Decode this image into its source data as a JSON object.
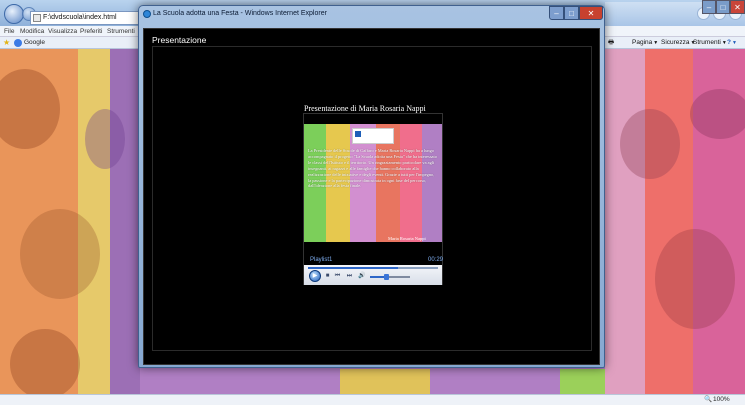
{
  "browser": {
    "address": "F:\\dvdscuola\\index.html",
    "menu": [
      "File",
      "Modifica",
      "Visualizza",
      "Preferiti",
      "Strumenti"
    ],
    "favorites": {
      "google_label": "Google"
    },
    "commands": {
      "page": "Pagina",
      "security": "Sicurezza",
      "tools": "Strumenti",
      "help": "?"
    },
    "zoom": "100%",
    "window_controls": {
      "minimize": "–",
      "maximize": "□",
      "close": "✕"
    }
  },
  "popup": {
    "title": "La Scuola adotta una Festa - Windows Internet Explorer",
    "heading": "Presentazione",
    "video_title": "Presentazione di Maria Rosaria Nappi",
    "slide": {
      "text": "La Presidente delle Scuole di Caffaro e Maria Rosaria Nappi ha a lungo accompagnato il progetto \"La Scuola adotta una Festa\" che ha interessato le classi dell'Istituto e il territorio. Un ringraziamento particolare va agli insegnanti, ai ragazzi e alle famiglie che hanno collaborato alla realizzazione delle iniziative e degli eventi. Grazie a tutti per l'impegno, la passione e la partecipazione dimostrata in ogni fase del percorso, dall'ideazione alla festa finale.",
      "signature": "Maria Rosaria Nappi"
    },
    "player": {
      "playlist": "Playlist1",
      "time": "00:29",
      "progress": 0.69,
      "volume": 0.4,
      "icons": {
        "play": "▶",
        "stop": "■",
        "prev": "⏮",
        "next": "⏭",
        "volume": "🔊"
      }
    },
    "controls": {
      "minimize": "–",
      "maximize": "□",
      "close": "✕"
    }
  }
}
